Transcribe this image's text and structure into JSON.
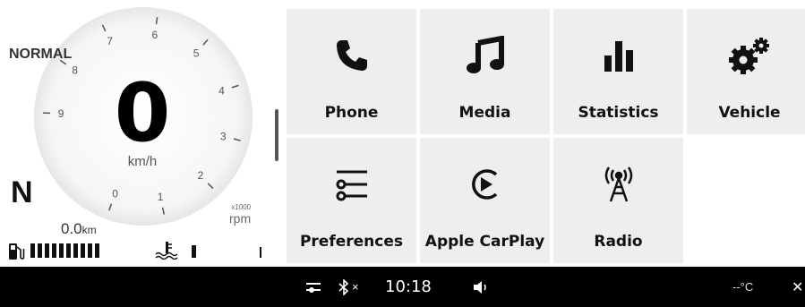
{
  "cluster": {
    "drive_mode": "NORMAL",
    "speed": "0",
    "speed_unit": "km/h",
    "gear": "N",
    "odometer_value": "0.0",
    "odometer_unit": "km",
    "rpm_multiplier": "x1000",
    "rpm_unit": "rpm",
    "tacho_ticks": [
      "0",
      "1",
      "2",
      "3",
      "4",
      "5",
      "6",
      "7",
      "8",
      "9"
    ],
    "fuel_level_segments": 10,
    "temperature_segments": 1
  },
  "menu": {
    "tiles": [
      {
        "label": "Phone",
        "icon": "phone-icon"
      },
      {
        "label": "Media",
        "icon": "music-note-icon"
      },
      {
        "label": "Statistics",
        "icon": "bar-chart-icon"
      },
      {
        "label": "Vehicle",
        "icon": "gears-icon"
      },
      {
        "label": "Preferences",
        "icon": "sliders-icon"
      },
      {
        "label": "Apple CarPlay",
        "icon": "carplay-icon"
      },
      {
        "label": "Radio",
        "icon": "antenna-icon"
      }
    ]
  },
  "status_bar": {
    "time": "10:18",
    "bluetooth_state": "×",
    "outside_temp": "--°C",
    "close_glyph": "✕"
  },
  "colors": {
    "tile_background": "#eeeeee",
    "status_bar_background": "#000000"
  }
}
